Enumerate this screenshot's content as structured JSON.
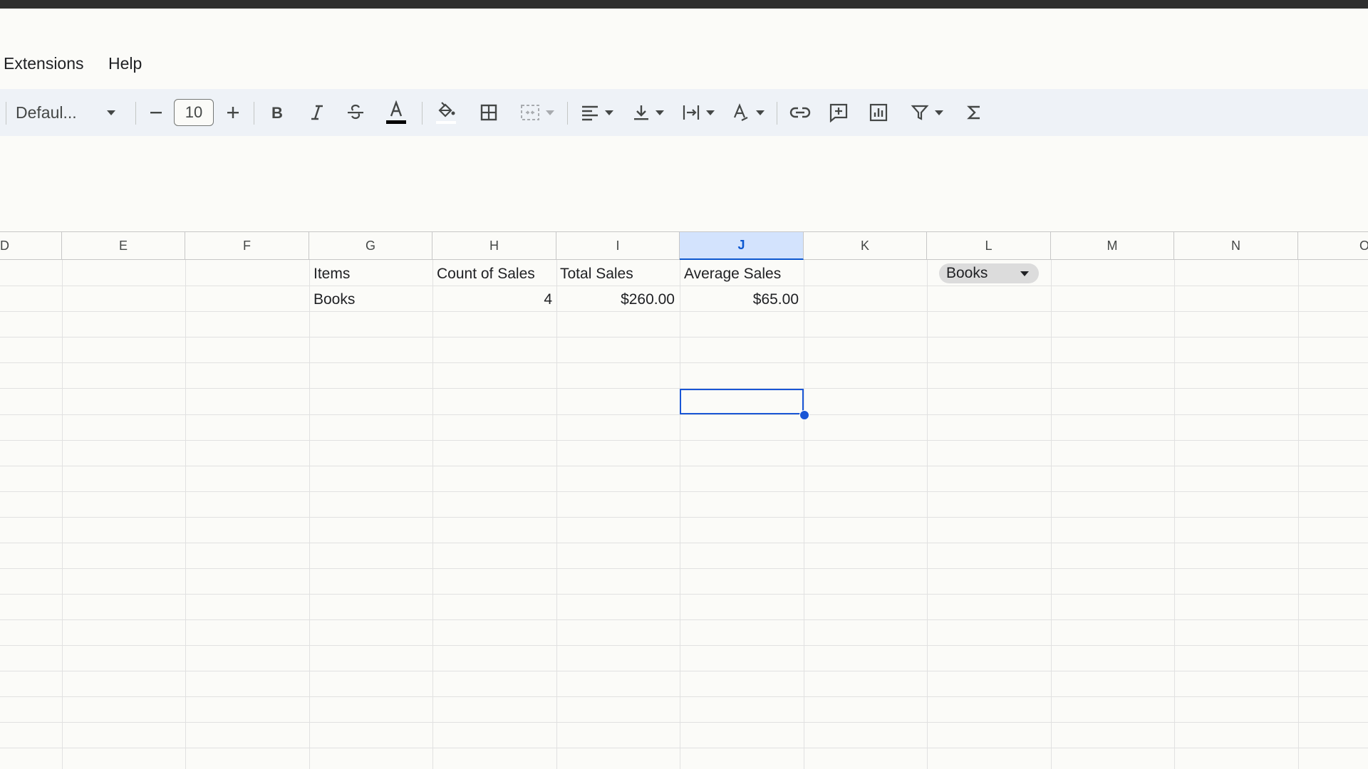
{
  "menu": {
    "extensions": "Extensions",
    "help": "Help"
  },
  "toolbar": {
    "font_name": "Defaul...",
    "font_size": "10",
    "colors": {
      "text_color_bar": "#000000",
      "icon": "#444746"
    }
  },
  "columns": [
    "D",
    "E",
    "F",
    "G",
    "H",
    "I",
    "J",
    "K",
    "L",
    "M",
    "N",
    "O"
  ],
  "selected_column": "J",
  "table": {
    "headers": {
      "items": "Items",
      "count": "Count of Sales",
      "total": "Total Sales",
      "average": "Average Sales"
    },
    "row1": {
      "item": "Books",
      "count": "4",
      "total": "$260.00",
      "average": "$65.00"
    }
  },
  "chip": {
    "label": "Books"
  }
}
